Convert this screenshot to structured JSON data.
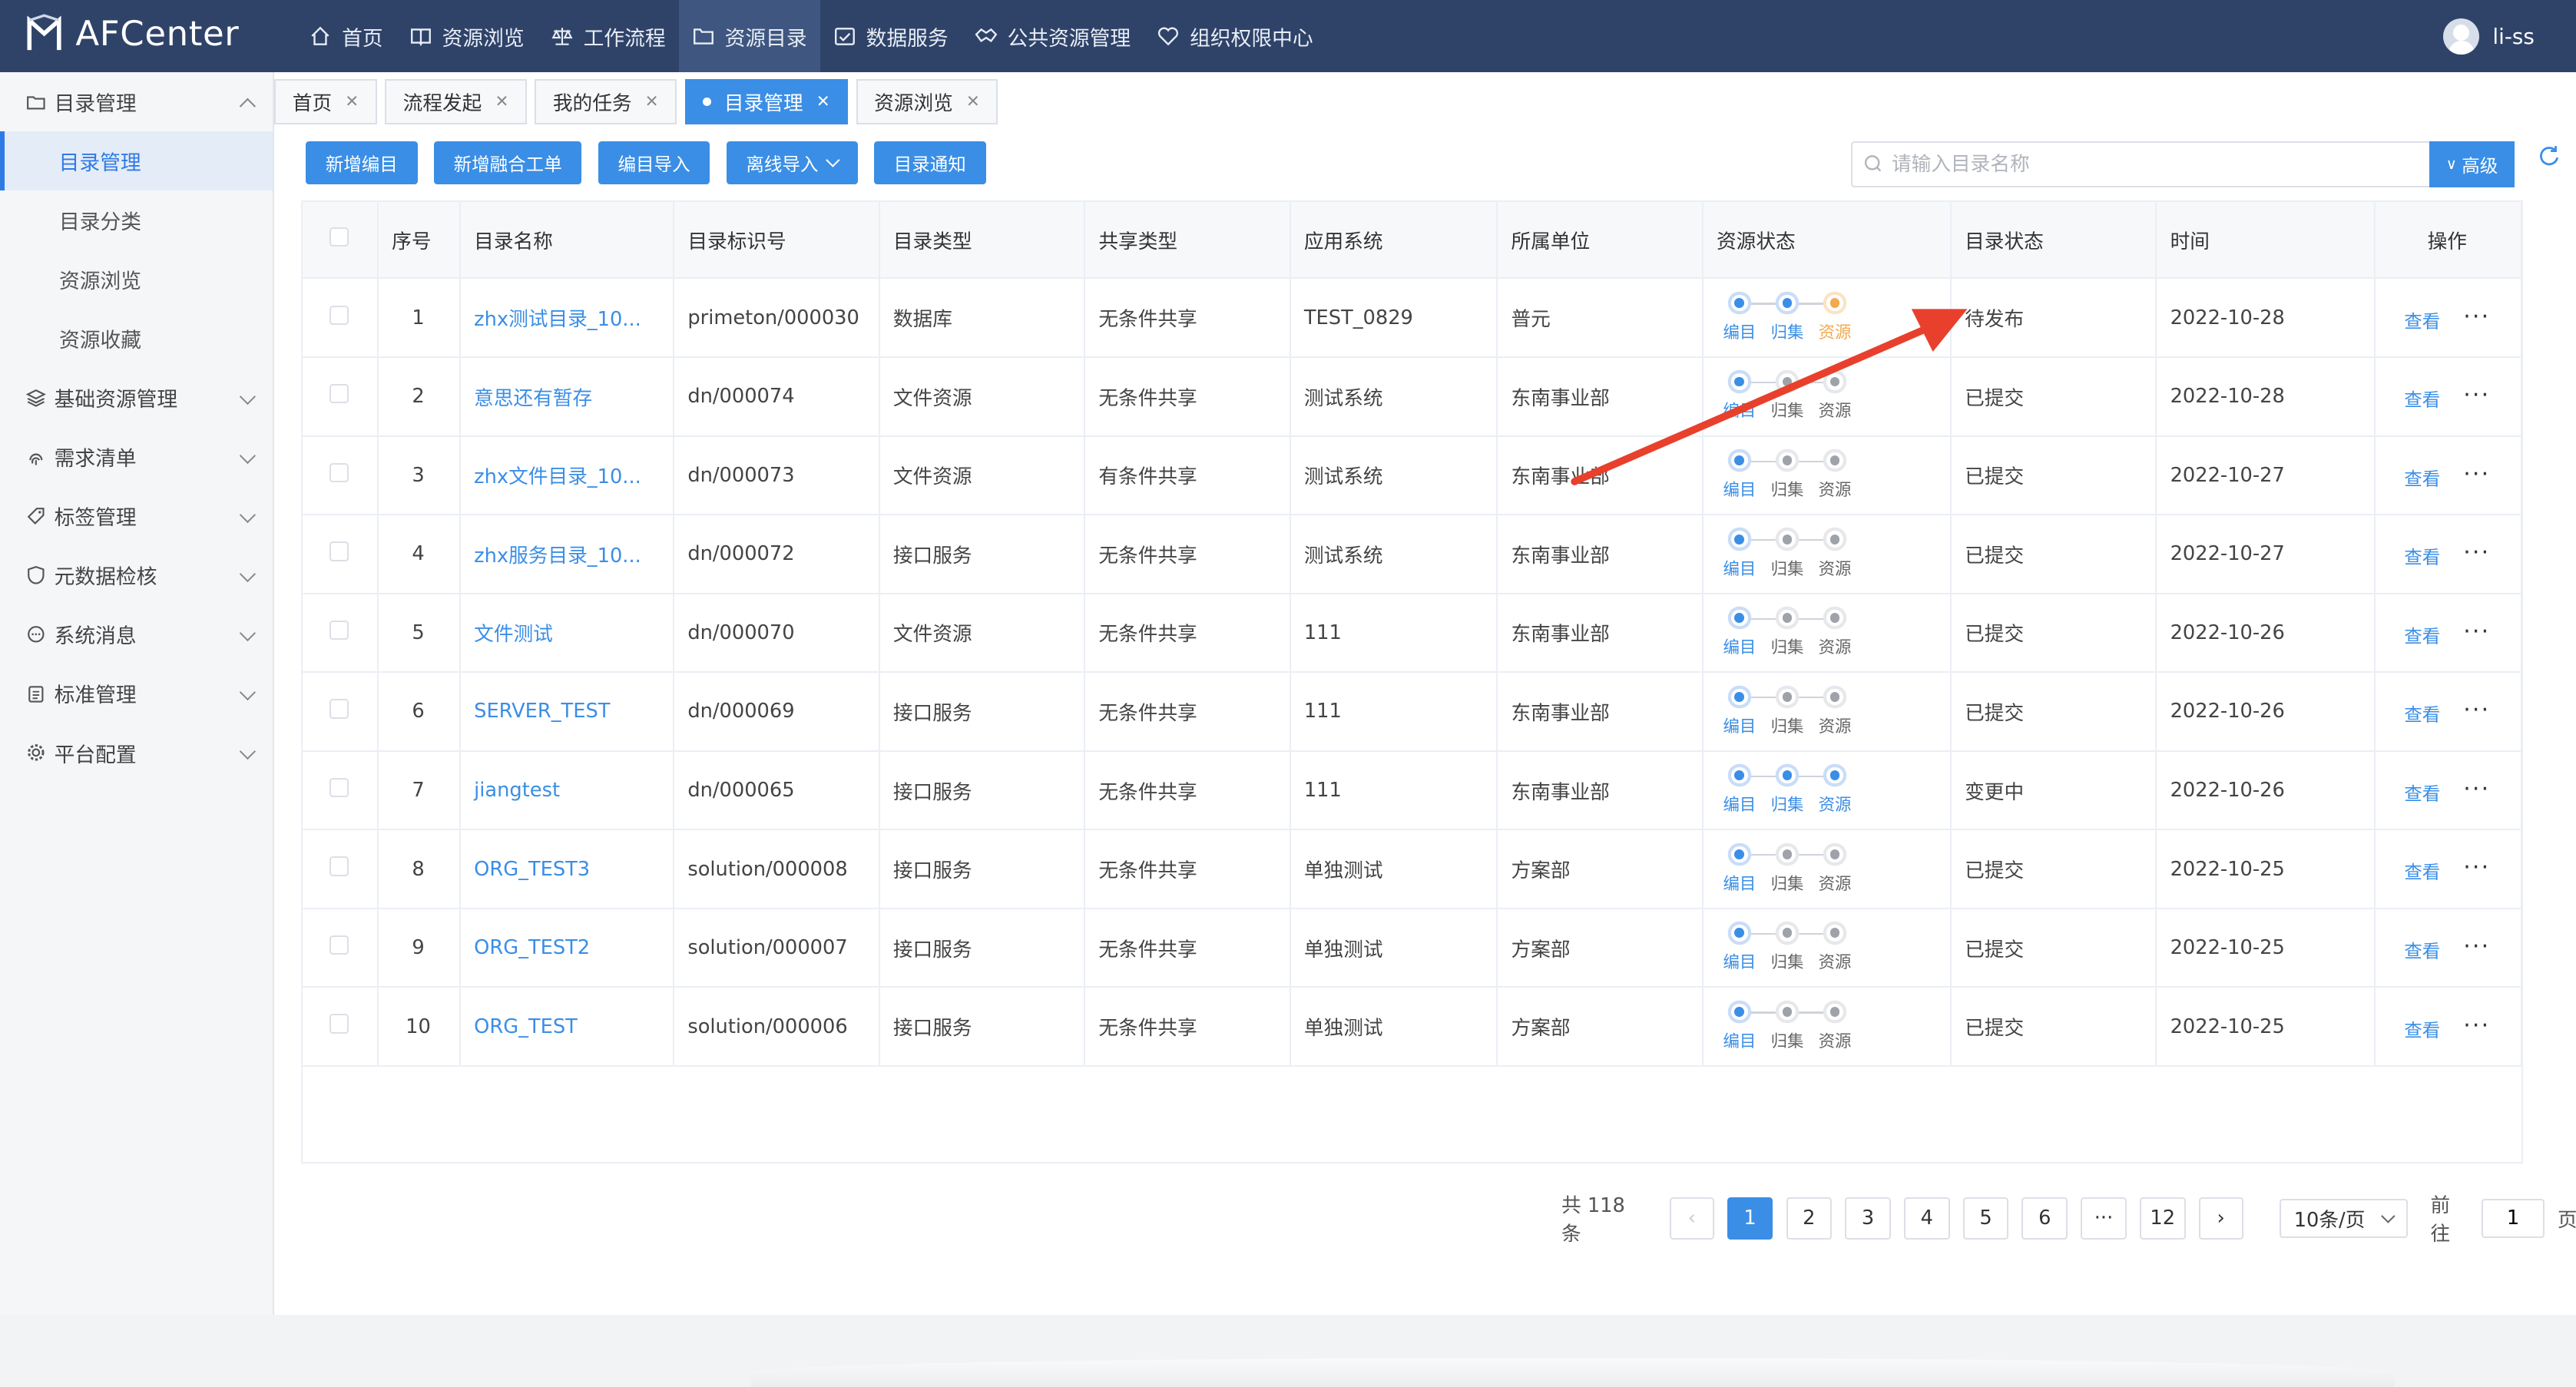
{
  "app": {
    "name": "AFCenter"
  },
  "nav": [
    {
      "label": "首页",
      "icon": "home-icon"
    },
    {
      "label": "资源浏览",
      "icon": "book-icon"
    },
    {
      "label": "工作流程",
      "icon": "scale-icon"
    },
    {
      "label": "资源目录",
      "icon": "folder-icon",
      "active": true
    },
    {
      "label": "数据服务",
      "icon": "calendar-check-icon"
    },
    {
      "label": "公共资源管理",
      "icon": "handshake-icon"
    },
    {
      "label": "组织权限中心",
      "icon": "heart-icon"
    }
  ],
  "user": {
    "name": "li-ss"
  },
  "sidebar": {
    "group_catalog": "目录管理",
    "sub_items": [
      "目录管理",
      "目录分类",
      "资源浏览",
      "资源收藏"
    ],
    "groups": [
      {
        "label": "基础资源管理",
        "icon": "layers-icon"
      },
      {
        "label": "需求清单",
        "icon": "fingerprint-icon"
      },
      {
        "label": "标签管理",
        "icon": "tag-icon"
      },
      {
        "label": "元数据检核",
        "icon": "shield-icon"
      },
      {
        "label": "系统消息",
        "icon": "chat-icon"
      },
      {
        "label": "标准管理",
        "icon": "clipboard-icon"
      },
      {
        "label": "平台配置",
        "icon": "gear-icon"
      }
    ]
  },
  "tabs": [
    "首页",
    "流程发起",
    "我的任务",
    "目录管理",
    "资源浏览"
  ],
  "toolbar": {
    "new_catalog": "新增编目",
    "new_merge": "新增融合工单",
    "import": "编目导入",
    "offline_import": "离线导入",
    "notify": "目录通知"
  },
  "search": {
    "placeholder": "请输入目录名称",
    "advanced": "高级"
  },
  "table": {
    "headers": [
      "序号",
      "目录名称",
      "目录标识号",
      "目录类型",
      "共享类型",
      "应用系统",
      "所属单位",
      "资源状态",
      "目录状态",
      "时间",
      "操作"
    ],
    "status_labels": [
      "编目",
      "归集",
      "资源"
    ],
    "view_label": "查看",
    "more_label": "···",
    "rows": [
      {
        "no": "1",
        "name": "zhx测试目录_10...",
        "id": "primeton/000030",
        "type": "数据库",
        "share": "无条件共享",
        "system": "TEST_0829",
        "unit": "普元",
        "res": [
          "on",
          "on",
          "warn"
        ],
        "state": "待发布",
        "time": "2022-10-28"
      },
      {
        "no": "2",
        "name": "意思还有暂存",
        "id": "dn/000074",
        "type": "文件资源",
        "share": "无条件共享",
        "system": "测试系统",
        "unit": "东南事业部",
        "res": [
          "on",
          "off",
          "off"
        ],
        "state": "已提交",
        "time": "2022-10-28"
      },
      {
        "no": "3",
        "name": "zhx文件目录_10...",
        "id": "dn/000073",
        "type": "文件资源",
        "share": "有条件共享",
        "system": "测试系统",
        "unit": "东南事业部",
        "res": [
          "on",
          "off",
          "off"
        ],
        "state": "已提交",
        "time": "2022-10-27"
      },
      {
        "no": "4",
        "name": "zhx服务目录_10...",
        "id": "dn/000072",
        "type": "接口服务",
        "share": "无条件共享",
        "system": "测试系统",
        "unit": "东南事业部",
        "res": [
          "on",
          "off",
          "off"
        ],
        "state": "已提交",
        "time": "2022-10-27"
      },
      {
        "no": "5",
        "name": "文件测试",
        "id": "dn/000070",
        "type": "文件资源",
        "share": "无条件共享",
        "system": "111",
        "unit": "东南事业部",
        "res": [
          "on",
          "off",
          "off"
        ],
        "state": "已提交",
        "time": "2022-10-26"
      },
      {
        "no": "6",
        "name": "SERVER_TEST",
        "id": "dn/000069",
        "type": "接口服务",
        "share": "无条件共享",
        "system": "111",
        "unit": "东南事业部",
        "res": [
          "on",
          "off",
          "off"
        ],
        "state": "已提交",
        "time": "2022-10-26"
      },
      {
        "no": "7",
        "name": "jiangtest",
        "id": "dn/000065",
        "type": "接口服务",
        "share": "无条件共享",
        "system": "111",
        "unit": "东南事业部",
        "res": [
          "on",
          "on",
          "on"
        ],
        "state": "变更中",
        "time": "2022-10-26"
      },
      {
        "no": "8",
        "name": "ORG_TEST3",
        "id": "solution/000008",
        "type": "接口服务",
        "share": "无条件共享",
        "system": "单独测试",
        "unit": "方案部",
        "res": [
          "on",
          "off",
          "off"
        ],
        "state": "已提交",
        "time": "2022-10-25"
      },
      {
        "no": "9",
        "name": "ORG_TEST2",
        "id": "solution/000007",
        "type": "接口服务",
        "share": "无条件共享",
        "system": "单独测试",
        "unit": "方案部",
        "res": [
          "on",
          "off",
          "off"
        ],
        "state": "已提交",
        "time": "2022-10-25"
      },
      {
        "no": "10",
        "name": "ORG_TEST",
        "id": "solution/000006",
        "type": "接口服务",
        "share": "无条件共享",
        "system": "单独测试",
        "unit": "方案部",
        "res": [
          "on",
          "off",
          "off"
        ],
        "state": "已提交",
        "time": "2022-10-25"
      }
    ]
  },
  "pagination": {
    "total": "共 118 条",
    "pages": [
      "1",
      "2",
      "3",
      "4",
      "5",
      "6",
      "···",
      "12"
    ],
    "current": "1",
    "page_size": "10条/页",
    "goto_prefix": "前往",
    "goto_value": "1",
    "goto_suffix": "页"
  },
  "colors": {
    "topbar": "#2f4369",
    "primary": "#3a8ee6",
    "warning": "#f2a950",
    "annotation_arrow": "#e8402c"
  }
}
